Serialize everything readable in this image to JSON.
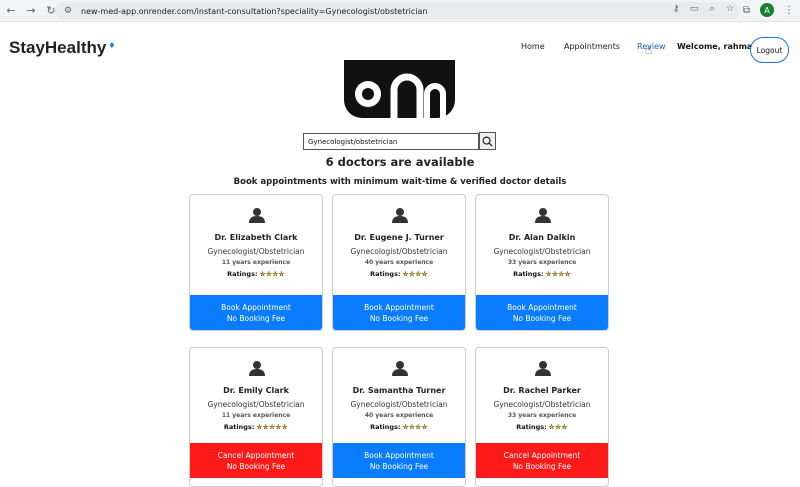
{
  "browser": {
    "url": "new-med-app.onrender.com/instant-consultation?speciality=Gynecologist/obstetrician",
    "profile_initial": "A"
  },
  "site": {
    "brand": "StayHealthy",
    "nav": {
      "home": "Home",
      "appointments": "Appointments",
      "review": "Review",
      "welcome": "Welcome, rahmat",
      "logout": "Logout"
    }
  },
  "search": {
    "value": "Gynecologist/obstetrician"
  },
  "results": {
    "count_text": "6 doctors are available",
    "subtitle": "Book appointments with minimum wait-time & verified doctor details"
  },
  "colors": {
    "book": "#0a7cff",
    "cancel": "#ff1a1a",
    "star": "#f4b400"
  },
  "doctors": [
    {
      "name": "Dr. Elizabeth Clark",
      "speciality": "Gynecologist/Obstetrician",
      "experience": "11 years experience",
      "ratings_label": "Ratings:",
      "stars": "★★★★",
      "action": "Book Appointment",
      "fee": "No Booking Fee",
      "state": "book"
    },
    {
      "name": "Dr. Eugene J. Turner",
      "speciality": "Gynecologist/Obstetrician",
      "experience": "40 years experience",
      "ratings_label": "Ratings:",
      "stars": "★★★★",
      "action": "Book Appointment",
      "fee": "No Booking Fee",
      "state": "book"
    },
    {
      "name": "Dr. Alan Dalkin",
      "speciality": "Gynecologist/Obstetrician",
      "experience": "33 years experience",
      "ratings_label": "Ratings:",
      "stars": "★★★★",
      "action": "Book Appointment",
      "fee": "No Booking Fee",
      "state": "book"
    },
    {
      "name": "Dr. Emily Clark",
      "speciality": "Gynecologist/Obstetrician",
      "experience": "11 years experience",
      "ratings_label": "Ratings:",
      "stars": "★★★★★",
      "action": "Cancel Appointment",
      "fee": "No Booking Fee",
      "state": "cancel"
    },
    {
      "name": "Dr. Samantha Turner",
      "speciality": "Gynecologist/Obstetrician",
      "experience": "40 years experience",
      "ratings_label": "Ratings:",
      "stars": "★★★★",
      "action": "Book Appointment",
      "fee": "No Booking Fee",
      "state": "book"
    },
    {
      "name": "Dr. Rachel Parker",
      "speciality": "Gynecologist/Obstetrician",
      "experience": "33 years experience",
      "ratings_label": "Ratings:",
      "stars": "★★★",
      "action": "Cancel Appointment",
      "fee": "No Booking Fee",
      "state": "cancel"
    }
  ]
}
